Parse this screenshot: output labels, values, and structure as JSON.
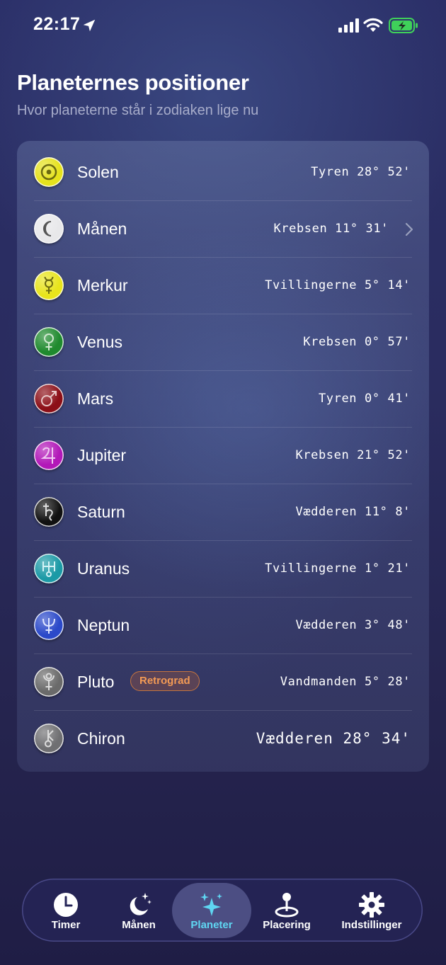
{
  "status_bar": {
    "time": "22:17"
  },
  "header": {
    "title": "Planeternes positioner",
    "subtitle": "Hvor planeterne står i zodiaken lige nu"
  },
  "planets": [
    {
      "name": "Solen",
      "position": "Tyren 28° 52'",
      "icon": "sun-icon",
      "color": "#e6e21c"
    },
    {
      "name": "Månen",
      "position": "Krebsen 11° 31'",
      "icon": "moon-icon",
      "color": "#e8e8ea"
    },
    {
      "name": "Merkur",
      "position": "Tvillingerne 5° 14'",
      "icon": "mercury-icon",
      "color": "#e8e41c"
    },
    {
      "name": "Venus",
      "position": "Krebsen 0° 57'",
      "icon": "venus-icon",
      "color": "#1f8a2e"
    },
    {
      "name": "Mars",
      "position": "Tyren 0° 41'",
      "icon": "mars-icon",
      "color": "#8c0f17"
    },
    {
      "name": "Jupiter",
      "position": "Krebsen 21° 52'",
      "icon": "jupiter-icon",
      "color": "#b218b8"
    },
    {
      "name": "Saturn",
      "position": "Vædderen 11° 8'",
      "icon": "saturn-icon",
      "color": "#111111"
    },
    {
      "name": "Uranus",
      "position": "Tvillingerne 1° 21'",
      "icon": "uranus-icon",
      "color": "#1b9aa6"
    },
    {
      "name": "Neptun",
      "position": "Vædderen 3° 48'",
      "icon": "neptune-icon",
      "color": "#2b49c9"
    },
    {
      "name": "Pluto",
      "position": "Vandmanden 5° 28'",
      "icon": "pluto-icon",
      "color": "#6a6a6a",
      "badge": "Retrograd"
    },
    {
      "name": "Chiron",
      "position": "Vædderen 28° 34'",
      "icon": "chiron-icon",
      "color": "#6f6f72"
    }
  ],
  "tabbar": {
    "tabs": [
      {
        "label": "Timer",
        "icon": "clock-icon"
      },
      {
        "label": "Månen",
        "icon": "moon-stars-icon"
      },
      {
        "label": "Planeter",
        "icon": "sparkles-icon",
        "active": true
      },
      {
        "label": "Placering",
        "icon": "location-pin-icon"
      },
      {
        "label": "Indstillinger",
        "icon": "gear-icon"
      }
    ]
  },
  "colors": {
    "accent_active_tab": "#5fd6f2",
    "badge_text": "#f39a55"
  }
}
